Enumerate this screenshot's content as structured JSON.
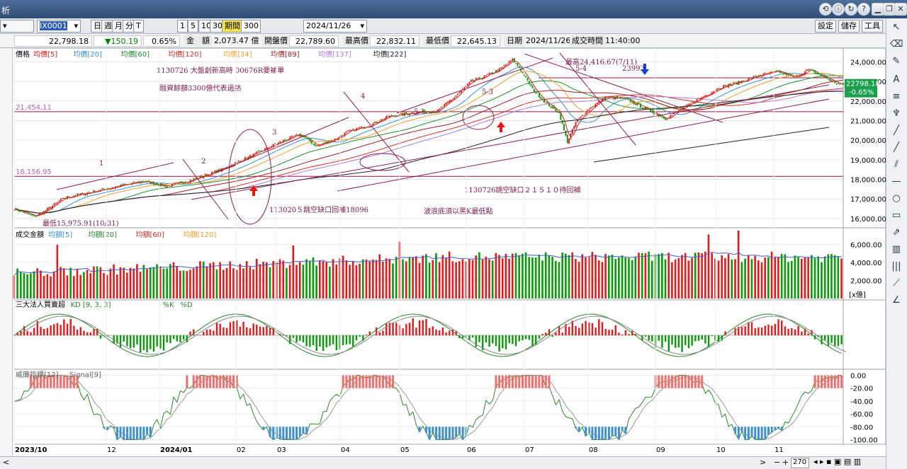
{
  "window": {
    "title_fragment": "析"
  },
  "toolbar": {
    "symbol": "IX0001",
    "period_buttons": [
      "日",
      "週",
      "月",
      "分",
      "T"
    ],
    "count_buttons": [
      "1",
      "5",
      "10",
      "30"
    ],
    "period_label": "期間",
    "period_value": "300",
    "date": "2024/11/26",
    "right_buttons": [
      "設定",
      "儲存",
      "工具"
    ]
  },
  "quote": {
    "price": "22,798.18",
    "change": "▼150.19",
    "change_pct": "0.65%",
    "amount_label": "金　額",
    "amount": "2,073.47 億",
    "open_label": "開盤價",
    "open": "22,789.60",
    "high_label": "最高價",
    "high": "22,832.11",
    "low_label": "最低價",
    "low": "22,645.13",
    "date_label": "日期",
    "date": "2024/11/26",
    "time_label": "成交時間",
    "time": "11:40:00"
  },
  "colors": {
    "up": "#e31a1c",
    "down": "#0a9a0a",
    "ma5": "#d81b1b",
    "ma20": "#3a8fd8",
    "ma60": "#1f8f2f",
    "ma120": "#d0302a",
    "ma34": "#f0a030",
    "ma89": "#9a2020",
    "ma137": "#b07be0",
    "ma222": "#222222"
  },
  "chart_data": [
    {
      "type": "line",
      "title": "",
      "legend": [
        "價格",
        "均價[5]",
        "均價[20]",
        "均價[60]",
        "均價[120]",
        "均價[34]",
        "均價[89]",
        "均價[137]",
        "均價[222]"
      ],
      "y_ticks": [
        "24,000.00",
        "23,000.00",
        "22,000.00",
        "21,000.00",
        "20,000.00",
        "19,000.00",
        "18,000.00",
        "17,000.00",
        "16,000.00"
      ],
      "ylim": [
        15600,
        24700
      ],
      "x_labels": [
        "2023/10",
        "12",
        "2024/01",
        "02",
        "03",
        "04",
        "05",
        "06",
        "07",
        "08",
        "09",
        "10",
        "11"
      ],
      "last_price": "22798.18",
      "last_change": "-0.65%",
      "hlines": [
        {
          "label": "21,454.11",
          "value": 21454.11
        },
        {
          "label": "18,156.95",
          "value": 18156.95
        }
      ],
      "close_keypoints": [
        [
          0,
          16500
        ],
        [
          12,
          16100
        ],
        [
          18,
          16350
        ],
        [
          30,
          17050
        ],
        [
          60,
          17600
        ],
        [
          78,
          17900
        ],
        [
          92,
          17650
        ],
        [
          108,
          18000
        ],
        [
          125,
          18500
        ],
        [
          140,
          19100
        ],
        [
          160,
          19900
        ],
        [
          172,
          20300
        ],
        [
          182,
          19700
        ],
        [
          192,
          20000
        ],
        [
          200,
          20400
        ],
        [
          215,
          20800
        ],
        [
          225,
          21200
        ],
        [
          240,
          21400
        ],
        [
          255,
          21500
        ],
        [
          265,
          22200
        ],
        [
          275,
          23000
        ],
        [
          282,
          23200
        ],
        [
          292,
          23600
        ],
        [
          300,
          24100
        ],
        [
          304,
          23700
        ],
        [
          312,
          22600
        ],
        [
          320,
          21900
        ],
        [
          328,
          21400
        ],
        [
          333,
          19900
        ],
        [
          338,
          20900
        ],
        [
          346,
          21600
        ],
        [
          356,
          22200
        ],
        [
          368,
          22100
        ],
        [
          378,
          21700
        ],
        [
          385,
          21400
        ],
        [
          392,
          21100
        ],
        [
          400,
          21500
        ],
        [
          412,
          22100
        ],
        [
          425,
          22700
        ],
        [
          438,
          23000
        ],
        [
          448,
          23300
        ],
        [
          460,
          23500
        ],
        [
          470,
          23200
        ],
        [
          478,
          23600
        ],
        [
          488,
          23200
        ],
        [
          495,
          22900
        ],
        [
          500,
          22800
        ]
      ],
      "annotations": [
        "1130726 大盤創新高時 00676R要補單",
        "融資餘額3300億代表過熱",
        "最高24,416.67(7/11)",
        "23993",
        "1130726跳空缺口２１５１０待回補",
        "113020５跳空缺口回補18096",
        "波浪底須以黑K最低點",
        "最低15,975.91(10/31)",
        "1",
        "2",
        "3",
        "4",
        "5-1",
        "5-3",
        "5-4"
      ]
    },
    {
      "type": "bar",
      "title": "成交金額",
      "legend": [
        "成交金額",
        "均額[5]",
        "均額[20]",
        "均額[60]",
        "均額[120]"
      ],
      "y_ticks": [
        "6,000.00",
        "4,000.00",
        "2,000.00"
      ],
      "ylim": [
        0,
        7200
      ],
      "unit": "[x億]"
    },
    {
      "type": "bar",
      "title": "三大法人買賣超",
      "legend": [
        "三大法人買賣超",
        "KD [9, 3, 3]",
        "%K",
        "%D"
      ]
    },
    {
      "type": "line",
      "title": "威廉指標",
      "legend": [
        "威廉指標[12]",
        "Signal[9]"
      ],
      "y_ticks": [
        "0.00",
        "-20.00",
        "-40.00",
        "-60.00",
        "-80.00",
        "-100.00"
      ],
      "ylim": [
        -105,
        5
      ]
    }
  ],
  "bottom": {
    "zoom": "270"
  }
}
